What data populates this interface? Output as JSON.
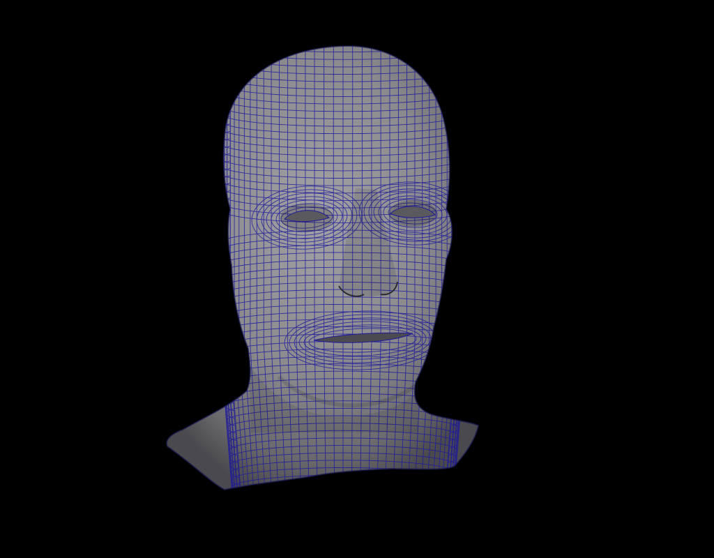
{
  "viewport": {
    "background_color": "#000000"
  },
  "model": {
    "subject": "head-bust-mesh",
    "surface_color": "#8e8e90",
    "wireframe_color": "#1e1a9a",
    "shading": "smooth-shaded-with-wireframe"
  }
}
